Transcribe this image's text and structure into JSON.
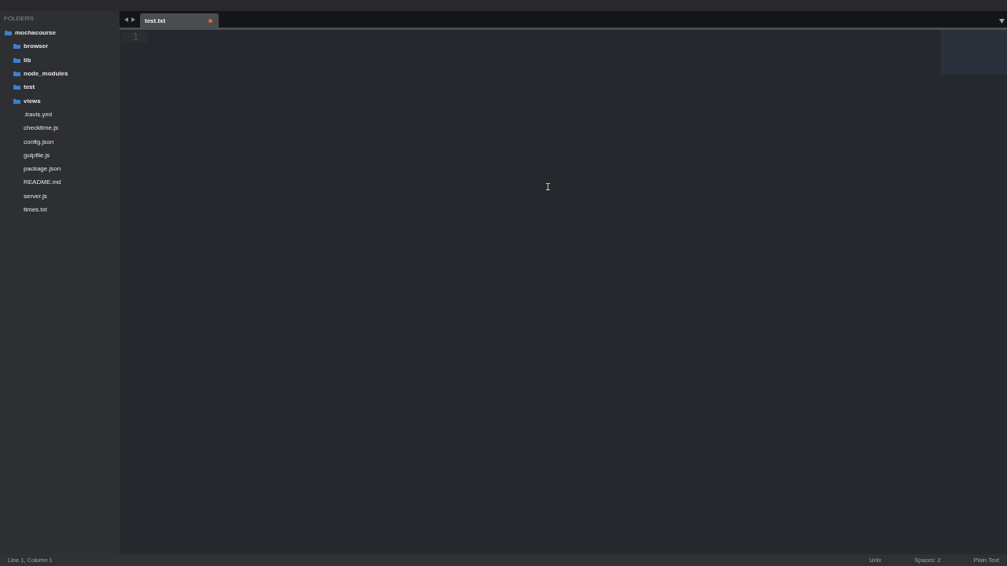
{
  "sidebar": {
    "header": "FOLDERS",
    "tree": [
      {
        "name": "mochacourse",
        "kind": "root",
        "children": [
          {
            "name": "browser",
            "kind": "folder"
          },
          {
            "name": "lib",
            "kind": "folder"
          },
          {
            "name": "node_modules",
            "kind": "folder"
          },
          {
            "name": "test",
            "kind": "folder"
          },
          {
            "name": "views",
            "kind": "folder"
          },
          {
            "name": ".travis.yml",
            "kind": "file"
          },
          {
            "name": "checktime.js",
            "kind": "file"
          },
          {
            "name": "config.json",
            "kind": "file"
          },
          {
            "name": "gulpfile.js",
            "kind": "file"
          },
          {
            "name": "package.json",
            "kind": "file"
          },
          {
            "name": "README.md",
            "kind": "file"
          },
          {
            "name": "server.js",
            "kind": "file"
          },
          {
            "name": "times.txt",
            "kind": "file"
          }
        ]
      }
    ]
  },
  "tabs": [
    {
      "label": "test.txt",
      "selected": true,
      "modified": true
    }
  ],
  "editor": {
    "line_numbers": [
      "1"
    ]
  },
  "status_bar": {
    "position": "Line 1, Column 1",
    "items": [
      "Unix",
      "Spaces: 2",
      "Plain Text"
    ]
  }
}
